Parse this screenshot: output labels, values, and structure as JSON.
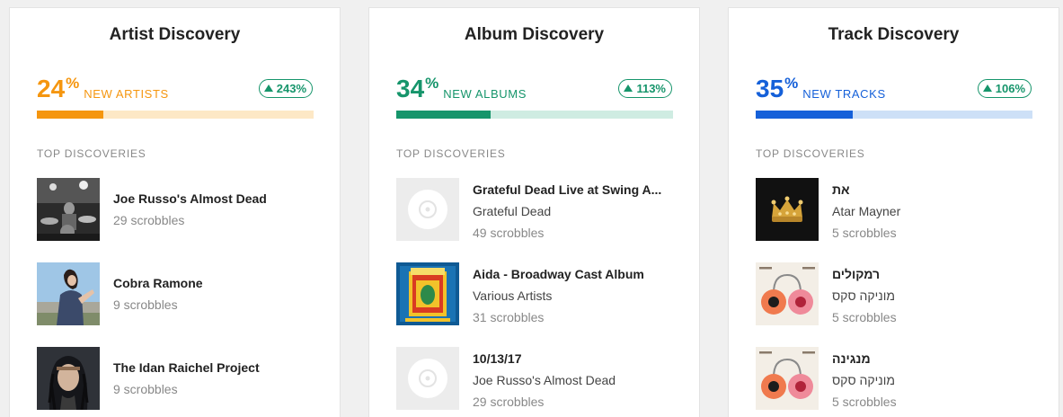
{
  "cards": [
    {
      "title": "Artist Discovery",
      "percent": "24",
      "percent_sign": "%",
      "label": "NEW ARTISTS",
      "change": "243%",
      "progress": 0.24,
      "accent": "#f5960f",
      "track": "#fde8c6",
      "top_label": "TOP DISCOVERIES",
      "items": [
        {
          "name": "Joe Russo's Almost Dead",
          "scrobbles": "29 scrobbles",
          "image": "band-photo"
        },
        {
          "name": "Cobra Ramone",
          "scrobbles": "9 scrobbles",
          "image": "artist-photo"
        },
        {
          "name": "The Idan Raichel Project",
          "scrobbles": "9 scrobbles",
          "image": "artist-photo"
        }
      ]
    },
    {
      "title": "Album Discovery",
      "percent": "34",
      "percent_sign": "%",
      "label": "NEW ALBUMS",
      "change": "113%",
      "progress": 0.34,
      "accent": "#16956b",
      "track": "#cfece2",
      "top_label": "TOP DISCOVERIES",
      "items": [
        {
          "name": "Grateful Dead Live at Swing A...",
          "artist": "Grateful Dead",
          "scrobbles": "49 scrobbles",
          "image": "placeholder-disc"
        },
        {
          "name": "Aida - Broadway Cast Album",
          "artist": "Various Artists",
          "scrobbles": "31 scrobbles",
          "image": "album-cover"
        },
        {
          "name": "10/13/17",
          "artist": "Joe Russo's Almost Dead",
          "scrobbles": "29 scrobbles",
          "image": "placeholder-disc"
        }
      ]
    },
    {
      "title": "Track Discovery",
      "percent": "35",
      "percent_sign": "%",
      "label": "NEW TRACKS",
      "change": "106%",
      "progress": 0.35,
      "accent": "#1560d9",
      "track": "#cde0f7",
      "top_label": "TOP DISCOVERIES",
      "items": [
        {
          "name": "את",
          "artist": "Atar Mayner",
          "scrobbles": "5 scrobbles",
          "image": "crown-cover"
        },
        {
          "name": "רמקולים",
          "artist": "מוניקה סקס",
          "scrobbles": "5 scrobbles",
          "image": "speakers-cover"
        },
        {
          "name": "מנגינה",
          "artist": "מוניקה סקס",
          "scrobbles": "5 scrobbles",
          "image": "speakers-cover"
        }
      ]
    }
  ]
}
